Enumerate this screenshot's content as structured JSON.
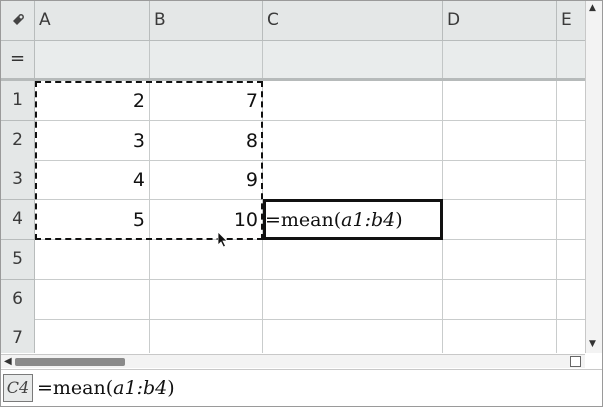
{
  "columns": [
    "A",
    "B",
    "C",
    "D",
    "E"
  ],
  "formula_row_label": "=",
  "rows": [
    "1",
    "2",
    "3",
    "4",
    "5",
    "6",
    "7"
  ],
  "cells": {
    "a1": "2",
    "b1": "7",
    "a2": "3",
    "b2": "8",
    "a3": "4",
    "b3": "9",
    "a4": "5",
    "b4": "10"
  },
  "active_cell": {
    "ref": "C4",
    "formula_prefix": "=mean(",
    "formula_range": "a1:b4",
    "formula_suffix": ")"
  },
  "entry_line": {
    "ref": "C4",
    "prefix": "=mean(",
    "range": "a1:b4",
    "suffix": ")"
  },
  "icons": {
    "corner": "variable-link-icon",
    "cursor": "mouse-pointer-icon"
  }
}
